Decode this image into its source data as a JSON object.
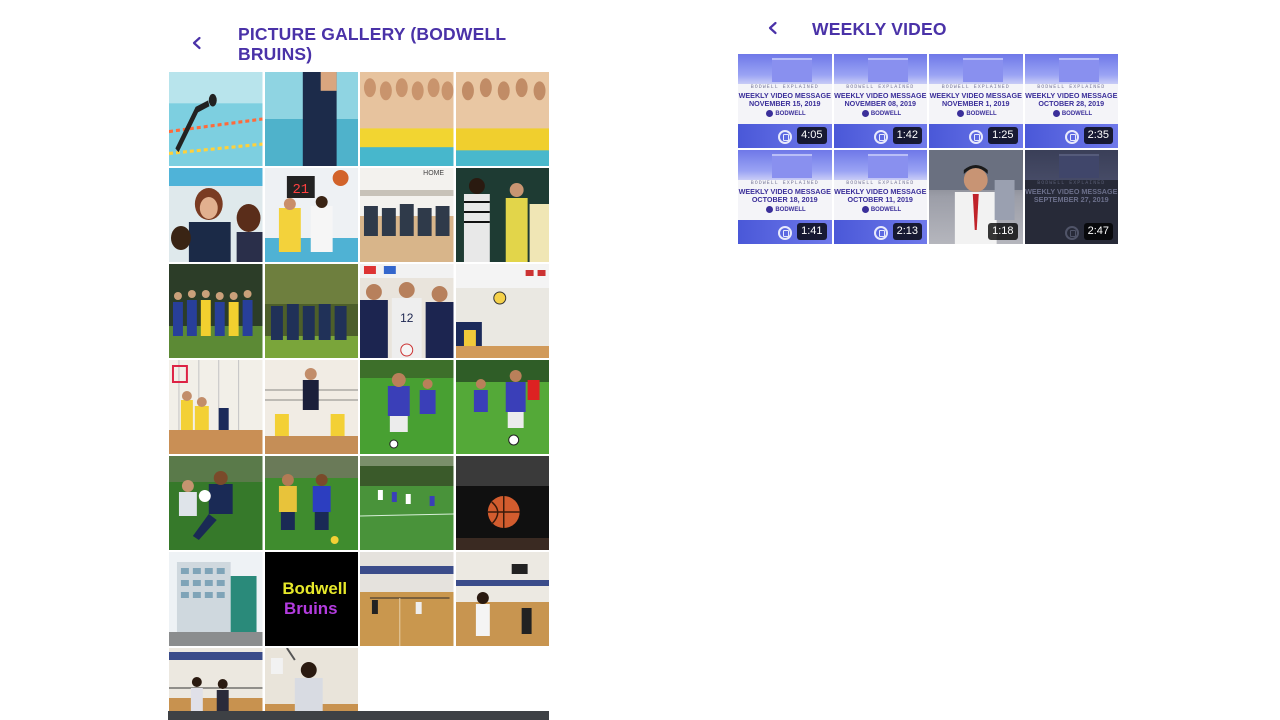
{
  "gallery": {
    "title": "PICTURE GALLERY (BODWELL BRUINS)",
    "back_icon": "chevron-left-icon",
    "photos": [
      {
        "name": "swimmer-diving"
      },
      {
        "name": "pool-coach"
      },
      {
        "name": "swim-team-group-1"
      },
      {
        "name": "swim-team-group-2"
      },
      {
        "name": "students-smiling"
      },
      {
        "name": "basketball-scoreboard-21",
        "label": "21"
      },
      {
        "name": "team-sitting-gym",
        "label": "HOME"
      },
      {
        "name": "referee-players"
      },
      {
        "name": "team-huddle-field"
      },
      {
        "name": "team-trees"
      },
      {
        "name": "volleyball-players-posing"
      },
      {
        "name": "volleyball-in-air"
      },
      {
        "name": "volleyball-spike"
      },
      {
        "name": "volleyball-jump"
      },
      {
        "name": "soccer-players-dribbling"
      },
      {
        "name": "soccer-players-chasing"
      },
      {
        "name": "soccer-tackle"
      },
      {
        "name": "soccer-duel"
      },
      {
        "name": "soccer-field-wide"
      },
      {
        "name": "basketball-closeup"
      },
      {
        "name": "school-building"
      },
      {
        "name": "bodwell-bruins-logo",
        "line1": "Bodwell",
        "line2": "Bruins"
      },
      {
        "name": "badminton-gym-1"
      },
      {
        "name": "badminton-gym-2"
      },
      {
        "name": "badminton-doubles"
      },
      {
        "name": "badminton-serve"
      }
    ]
  },
  "weekly_video": {
    "title": "WEEKLY VIDEO",
    "back_icon": "chevron-left-icon",
    "series_label": "BODWELL EXPLAINED",
    "videos": [
      {
        "headline": "WEEKLY VIDEO MESSAGE",
        "date": "NOVEMBER 15, 2019",
        "duration": "4:05",
        "style": "light"
      },
      {
        "headline": "WEEKLY VIDEO MESSAGE",
        "date": "NOVEMBER 08, 2019",
        "duration": "1:42",
        "style": "light"
      },
      {
        "headline": "WEEKLY VIDEO MESSAGE",
        "date": "NOVEMBER 1, 2019",
        "duration": "1:25",
        "style": "light"
      },
      {
        "headline": "WEEKLY VIDEO MESSAGE",
        "date": "OCTOBER 28, 2019",
        "duration": "2:35",
        "style": "light"
      },
      {
        "headline": "WEEKLY VIDEO MESSAGE",
        "date": "OCTOBER 18, 2019",
        "duration": "1:41",
        "style": "light"
      },
      {
        "headline": "WEEKLY VIDEO MESSAGE",
        "date": "OCTOBER 11, 2019",
        "duration": "2:13",
        "style": "light"
      },
      {
        "headline": "",
        "date": "",
        "duration": "1:18",
        "style": "person"
      },
      {
        "headline": "WEEKLY VIDEO MESSAGE",
        "date": "SEPTEMBER 27, 2019",
        "duration": "2:47",
        "style": "dark"
      }
    ],
    "logo_text": "BODWELL"
  },
  "colors": {
    "accent": "#4a32a8",
    "bottom_bar": "#3e4145"
  }
}
